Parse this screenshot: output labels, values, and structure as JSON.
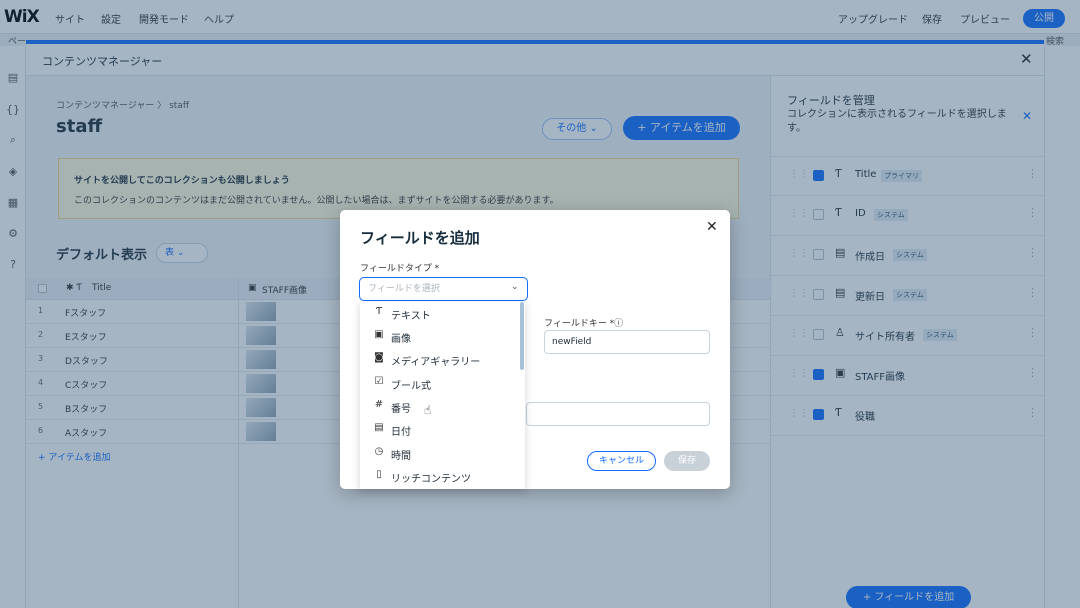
{
  "topbar": {
    "logo": "WiX",
    "menu": [
      "サイト",
      "設定",
      "開発モード",
      "ヘルプ"
    ],
    "upgrade": "アップグレード",
    "save": "保存",
    "preview": "プレビュー",
    "publish": "公開"
  },
  "secondbar": {
    "left": "ペー",
    "right": "検索"
  },
  "modal": {
    "title": "コンテンツマネージャー",
    "breadcrumb": "コンテンツマネージャー 〉 staff",
    "page_title": "staff",
    "more_label": "その他 ⌄",
    "add_item_label": "+ アイテムを追加",
    "notice_title": "サイトを公開してこのコレクションも公開しましょう",
    "notice_text": "このコレクションのコンテンツはまだ公開されていません。公開したい場合は、まずサイトを公開する必要があります。",
    "view_title": "デフォルト表示",
    "view_select": "表 ⌄"
  },
  "table": {
    "col_title": "Title",
    "col_image": "STAFF画像",
    "rows": [
      {
        "num": "1",
        "name": "Fスタッフ"
      },
      {
        "num": "2",
        "name": "Eスタッフ"
      },
      {
        "num": "3",
        "name": "Dスタッフ"
      },
      {
        "num": "4",
        "name": "Cスタッフ"
      },
      {
        "num": "5",
        "name": "Bスタッフ"
      },
      {
        "num": "6",
        "name": "Aスタッフ"
      }
    ],
    "add_item_link": "+ アイテムを追加"
  },
  "right_panel": {
    "title": "フィールドを管理",
    "description": "コレクションに表示されるフィールドを選択します。",
    "fields": [
      {
        "name": "Title",
        "badge": "プライマリ",
        "checked": true,
        "icon": "text-icon"
      },
      {
        "name": "ID",
        "badge": "システム",
        "checked": false,
        "icon": "text-icon"
      },
      {
        "name": "作成日",
        "badge": "システム",
        "checked": false,
        "icon": "calendar-icon"
      },
      {
        "name": "更新日",
        "badge": "システム",
        "checked": false,
        "icon": "calendar-icon"
      },
      {
        "name": "サイト所有者",
        "badge": "システム",
        "checked": false,
        "icon": "person-icon"
      },
      {
        "name": "STAFF画像",
        "badge": "",
        "checked": true,
        "icon": "image-icon"
      },
      {
        "name": "役職",
        "badge": "",
        "checked": true,
        "icon": "text-icon"
      }
    ],
    "add_field_label": "+ フィールドを追加"
  },
  "dialog": {
    "title": "フィールドを追加",
    "type_label": "フィールドタイプ *",
    "type_placeholder": "フィールドを選択",
    "options": [
      {
        "icon": "Ƭ",
        "label": "テキスト",
        "name": "text"
      },
      {
        "icon": "▣",
        "label": "画像",
        "name": "image"
      },
      {
        "icon": "◙",
        "label": "メディアギャラリー",
        "name": "media-gallery"
      },
      {
        "icon": "☑",
        "label": "ブール式",
        "name": "boolean"
      },
      {
        "icon": "#",
        "label": "番号",
        "name": "number"
      },
      {
        "icon": "▤",
        "label": "日付",
        "name": "date"
      },
      {
        "icon": "◷",
        "label": "時間",
        "name": "time"
      },
      {
        "icon": "▯",
        "label": "リッチコンテンツ",
        "name": "rich-content"
      }
    ],
    "key_label": "フィールドキー *ⓘ",
    "key_value": "newField",
    "cancel": "キャンセル",
    "save": "保存"
  },
  "colors": {
    "accent": "#116dff",
    "overlay": "#2a4e70"
  }
}
